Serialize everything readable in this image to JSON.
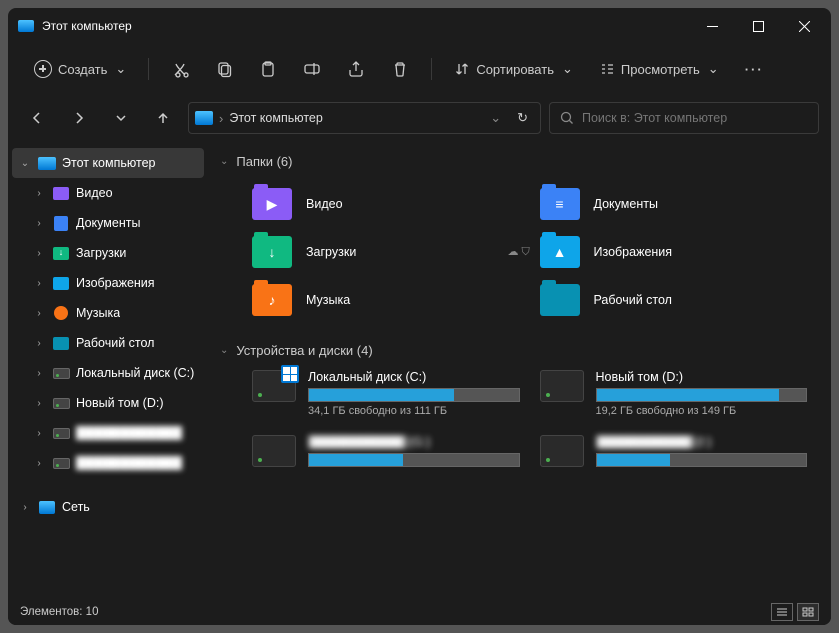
{
  "title": "Этот компьютер",
  "toolbar": {
    "create": "Создать",
    "sort": "Сортировать",
    "view": "Просмотреть"
  },
  "address": {
    "sep": "›",
    "current": "Этот компьютер"
  },
  "search": {
    "placeholder": "Поиск в: Этот компьютер"
  },
  "sidebar": [
    {
      "label": "Этот компьютер",
      "icon": "pc",
      "sel": true,
      "exp": "v",
      "lvl": 0
    },
    {
      "label": "Видео",
      "icon": "video",
      "exp": ">",
      "lvl": 1
    },
    {
      "label": "Документы",
      "icon": "docs",
      "exp": ">",
      "lvl": 1
    },
    {
      "label": "Загрузки",
      "icon": "down",
      "exp": ">",
      "lvl": 1
    },
    {
      "label": "Изображения",
      "icon": "img",
      "exp": ">",
      "lvl": 1
    },
    {
      "label": "Музыка",
      "icon": "music",
      "exp": ">",
      "lvl": 1
    },
    {
      "label": "Рабочий стол",
      "icon": "desk",
      "exp": ">",
      "lvl": 1
    },
    {
      "label": "Локальный диск (C:)",
      "icon": "disk",
      "exp": ">",
      "lvl": 1
    },
    {
      "label": "Новый том (D:)",
      "icon": "disk",
      "exp": ">",
      "lvl": 1
    },
    {
      "label": "████████████",
      "icon": "disk",
      "exp": ">",
      "lvl": 1,
      "blur": true
    },
    {
      "label": "████████████",
      "icon": "disk",
      "exp": ">",
      "lvl": 1,
      "blur": true
    },
    {
      "label": "Сеть",
      "icon": "net",
      "exp": ">",
      "lvl": 0
    }
  ],
  "groups": {
    "folders_title": "Папки (6)",
    "drives_title": "Устройства и диски (4)"
  },
  "folders": [
    {
      "label": "Видео",
      "color": "#8b5cf6",
      "glyph": "▶"
    },
    {
      "label": "Документы",
      "color": "#3b82f6",
      "glyph": "≡"
    },
    {
      "label": "Загрузки",
      "color": "#10b981",
      "glyph": "↓"
    },
    {
      "label": "Изображения",
      "color": "#0ea5e9",
      "glyph": "▲",
      "badge": true
    },
    {
      "label": "Музыка",
      "color": "#f97316",
      "glyph": "♪"
    },
    {
      "label": "Рабочий стол",
      "color": "#0891b2",
      "glyph": ""
    }
  ],
  "drives": [
    {
      "name": "Локальный диск (C:)",
      "free": "34,1 ГБ свободно из 111 ГБ",
      "fill": 69,
      "os": true
    },
    {
      "name": "Новый том (D:)",
      "free": "19,2 ГБ свободно из 149 ГБ",
      "fill": 87
    },
    {
      "name": "████████████  (G:)",
      "free": "",
      "fill": 45,
      "blur": true,
      "shortname": "(G:)"
    },
    {
      "name": "████████████  (I:)",
      "free": "",
      "fill": 35,
      "blur": true,
      "shortname": "(I:)"
    }
  ],
  "status": {
    "items": "Элементов: 10"
  }
}
